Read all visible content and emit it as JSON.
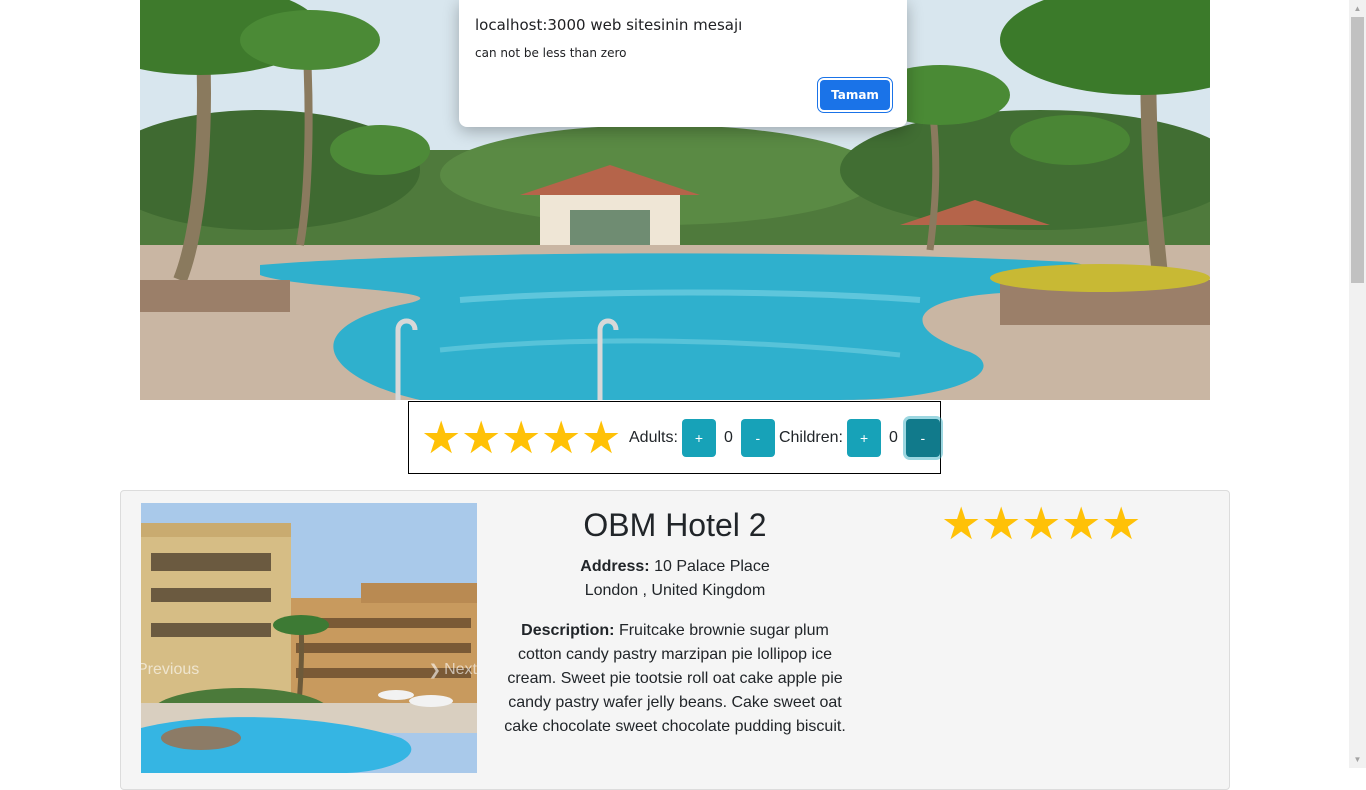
{
  "alert": {
    "title": "localhost:3000 web sitesinin mesajı",
    "message": "can not be less than zero",
    "ok_label": "Tamam"
  },
  "filter": {
    "stars": [
      "★",
      "★",
      "★",
      "★",
      "★"
    ],
    "adults_label": "Adults:",
    "adults_count": "0",
    "children_label": "Children:",
    "children_count": "0",
    "plus_label": "+",
    "minus_label": "-"
  },
  "hotel": {
    "name": "OBM Hotel 2",
    "address_label": "Address:",
    "address_line1": "10 Palace Place",
    "address_line2": "London , United Kingdom",
    "description_label": "Description:",
    "description": "Fruitcake brownie sugar plum cotton candy pastry marzipan pie lollipop ice cream. Sweet pie tootsie roll oat cake apple pie candy pastry wafer jelly beans. Cake sweet oat cake chocolate sweet chocolate pudding biscuit.",
    "rating_stars": [
      "★",
      "★",
      "★",
      "★",
      "★"
    ],
    "carousel_prev": "Previous",
    "carousel_next": "Next"
  },
  "colors": {
    "star": "#ffc107",
    "button_teal": "#17a2b8",
    "alert_button": "#1a73e8"
  }
}
